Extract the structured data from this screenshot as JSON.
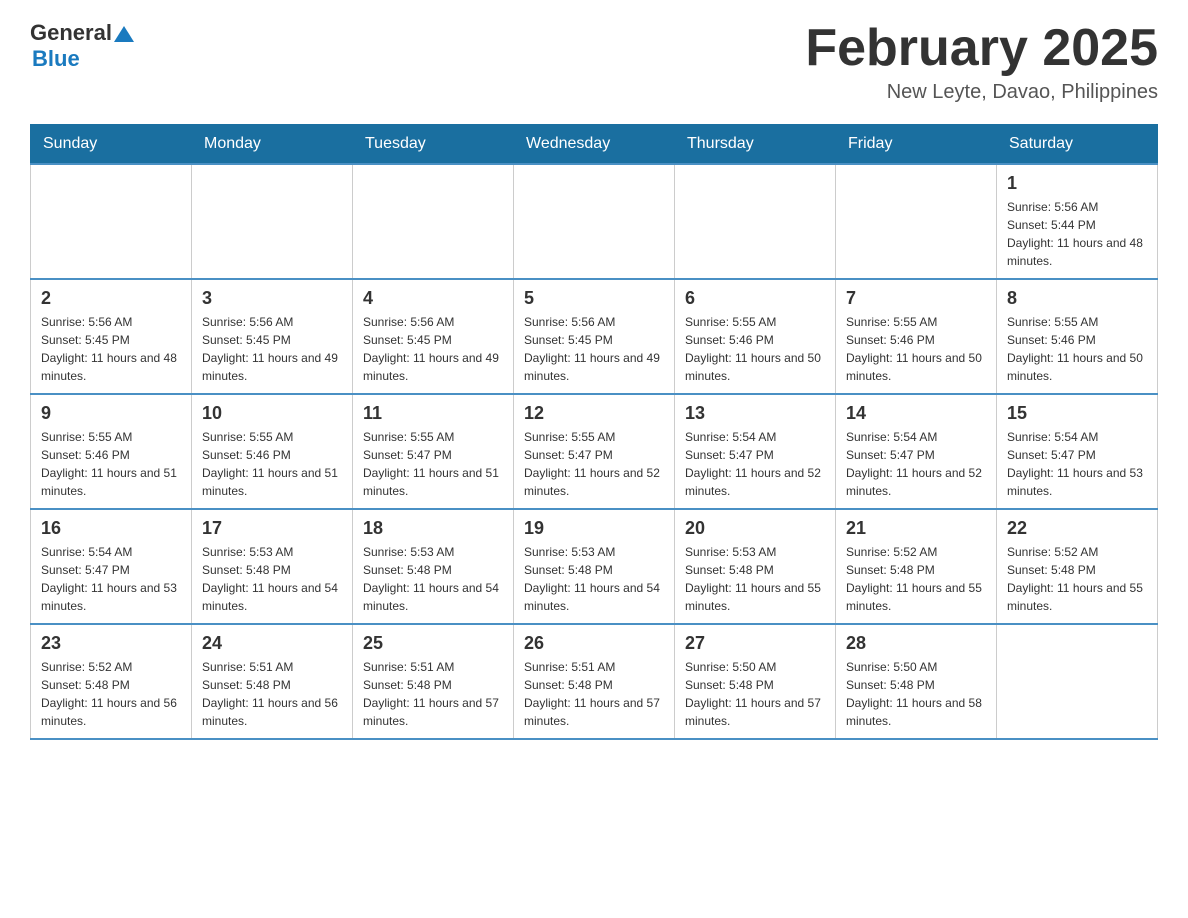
{
  "header": {
    "logo": {
      "general": "General",
      "blue": "Blue"
    },
    "title": "February 2025",
    "location": "New Leyte, Davao, Philippines"
  },
  "days_of_week": [
    "Sunday",
    "Monday",
    "Tuesday",
    "Wednesday",
    "Thursday",
    "Friday",
    "Saturday"
  ],
  "weeks": [
    [
      {
        "day": "",
        "info": ""
      },
      {
        "day": "",
        "info": ""
      },
      {
        "day": "",
        "info": ""
      },
      {
        "day": "",
        "info": ""
      },
      {
        "day": "",
        "info": ""
      },
      {
        "day": "",
        "info": ""
      },
      {
        "day": "1",
        "info": "Sunrise: 5:56 AM\nSunset: 5:44 PM\nDaylight: 11 hours and 48 minutes."
      }
    ],
    [
      {
        "day": "2",
        "info": "Sunrise: 5:56 AM\nSunset: 5:45 PM\nDaylight: 11 hours and 48 minutes."
      },
      {
        "day": "3",
        "info": "Sunrise: 5:56 AM\nSunset: 5:45 PM\nDaylight: 11 hours and 49 minutes."
      },
      {
        "day": "4",
        "info": "Sunrise: 5:56 AM\nSunset: 5:45 PM\nDaylight: 11 hours and 49 minutes."
      },
      {
        "day": "5",
        "info": "Sunrise: 5:56 AM\nSunset: 5:45 PM\nDaylight: 11 hours and 49 minutes."
      },
      {
        "day": "6",
        "info": "Sunrise: 5:55 AM\nSunset: 5:46 PM\nDaylight: 11 hours and 50 minutes."
      },
      {
        "day": "7",
        "info": "Sunrise: 5:55 AM\nSunset: 5:46 PM\nDaylight: 11 hours and 50 minutes."
      },
      {
        "day": "8",
        "info": "Sunrise: 5:55 AM\nSunset: 5:46 PM\nDaylight: 11 hours and 50 minutes."
      }
    ],
    [
      {
        "day": "9",
        "info": "Sunrise: 5:55 AM\nSunset: 5:46 PM\nDaylight: 11 hours and 51 minutes."
      },
      {
        "day": "10",
        "info": "Sunrise: 5:55 AM\nSunset: 5:46 PM\nDaylight: 11 hours and 51 minutes."
      },
      {
        "day": "11",
        "info": "Sunrise: 5:55 AM\nSunset: 5:47 PM\nDaylight: 11 hours and 51 minutes."
      },
      {
        "day": "12",
        "info": "Sunrise: 5:55 AM\nSunset: 5:47 PM\nDaylight: 11 hours and 52 minutes."
      },
      {
        "day": "13",
        "info": "Sunrise: 5:54 AM\nSunset: 5:47 PM\nDaylight: 11 hours and 52 minutes."
      },
      {
        "day": "14",
        "info": "Sunrise: 5:54 AM\nSunset: 5:47 PM\nDaylight: 11 hours and 52 minutes."
      },
      {
        "day": "15",
        "info": "Sunrise: 5:54 AM\nSunset: 5:47 PM\nDaylight: 11 hours and 53 minutes."
      }
    ],
    [
      {
        "day": "16",
        "info": "Sunrise: 5:54 AM\nSunset: 5:47 PM\nDaylight: 11 hours and 53 minutes."
      },
      {
        "day": "17",
        "info": "Sunrise: 5:53 AM\nSunset: 5:48 PM\nDaylight: 11 hours and 54 minutes."
      },
      {
        "day": "18",
        "info": "Sunrise: 5:53 AM\nSunset: 5:48 PM\nDaylight: 11 hours and 54 minutes."
      },
      {
        "day": "19",
        "info": "Sunrise: 5:53 AM\nSunset: 5:48 PM\nDaylight: 11 hours and 54 minutes."
      },
      {
        "day": "20",
        "info": "Sunrise: 5:53 AM\nSunset: 5:48 PM\nDaylight: 11 hours and 55 minutes."
      },
      {
        "day": "21",
        "info": "Sunrise: 5:52 AM\nSunset: 5:48 PM\nDaylight: 11 hours and 55 minutes."
      },
      {
        "day": "22",
        "info": "Sunrise: 5:52 AM\nSunset: 5:48 PM\nDaylight: 11 hours and 55 minutes."
      }
    ],
    [
      {
        "day": "23",
        "info": "Sunrise: 5:52 AM\nSunset: 5:48 PM\nDaylight: 11 hours and 56 minutes."
      },
      {
        "day": "24",
        "info": "Sunrise: 5:51 AM\nSunset: 5:48 PM\nDaylight: 11 hours and 56 minutes."
      },
      {
        "day": "25",
        "info": "Sunrise: 5:51 AM\nSunset: 5:48 PM\nDaylight: 11 hours and 57 minutes."
      },
      {
        "day": "26",
        "info": "Sunrise: 5:51 AM\nSunset: 5:48 PM\nDaylight: 11 hours and 57 minutes."
      },
      {
        "day": "27",
        "info": "Sunrise: 5:50 AM\nSunset: 5:48 PM\nDaylight: 11 hours and 57 minutes."
      },
      {
        "day": "28",
        "info": "Sunrise: 5:50 AM\nSunset: 5:48 PM\nDaylight: 11 hours and 58 minutes."
      },
      {
        "day": "",
        "info": ""
      }
    ]
  ]
}
